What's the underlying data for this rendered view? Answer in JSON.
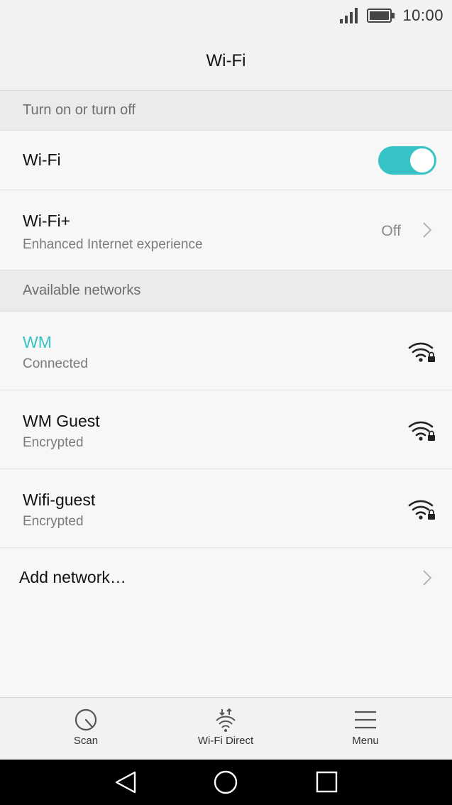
{
  "colors": {
    "accent": "#36c3c6",
    "background": "#f7f7f7",
    "section": "#ebebeb"
  },
  "status_bar": {
    "time": "10:00",
    "icons": [
      "signal-icon",
      "battery-icon"
    ]
  },
  "header": {
    "title": "Wi-Fi"
  },
  "sections": {
    "toggle_section": "Turn on or turn off",
    "networks_section": "Available networks"
  },
  "wifi_row": {
    "label": "Wi-Fi",
    "enabled": true
  },
  "wifi_plus_row": {
    "label": "Wi-Fi+",
    "subtitle": "Enhanced Internet experience",
    "value": "Off"
  },
  "networks": [
    {
      "name": "WM",
      "status": "Connected",
      "icon": "wifi-lock-icon"
    },
    {
      "name": "WM Guest",
      "status": "Encrypted",
      "icon": "wifi-lock-icon"
    },
    {
      "name": "Wifi-guest",
      "status": "Encrypted",
      "icon": "wifi-lock-icon"
    }
  ],
  "add_network": {
    "label": "Add network…"
  },
  "bottom_bar": {
    "scan": {
      "label": "Scan",
      "icon": "scan-icon"
    },
    "wifi_direct": {
      "label": "Wi-Fi Direct",
      "icon": "wifi-direct-icon"
    },
    "menu": {
      "label": "Menu",
      "icon": "menu-icon"
    }
  },
  "nav_bar": {
    "buttons": [
      "back-icon",
      "home-icon",
      "recents-icon"
    ]
  }
}
